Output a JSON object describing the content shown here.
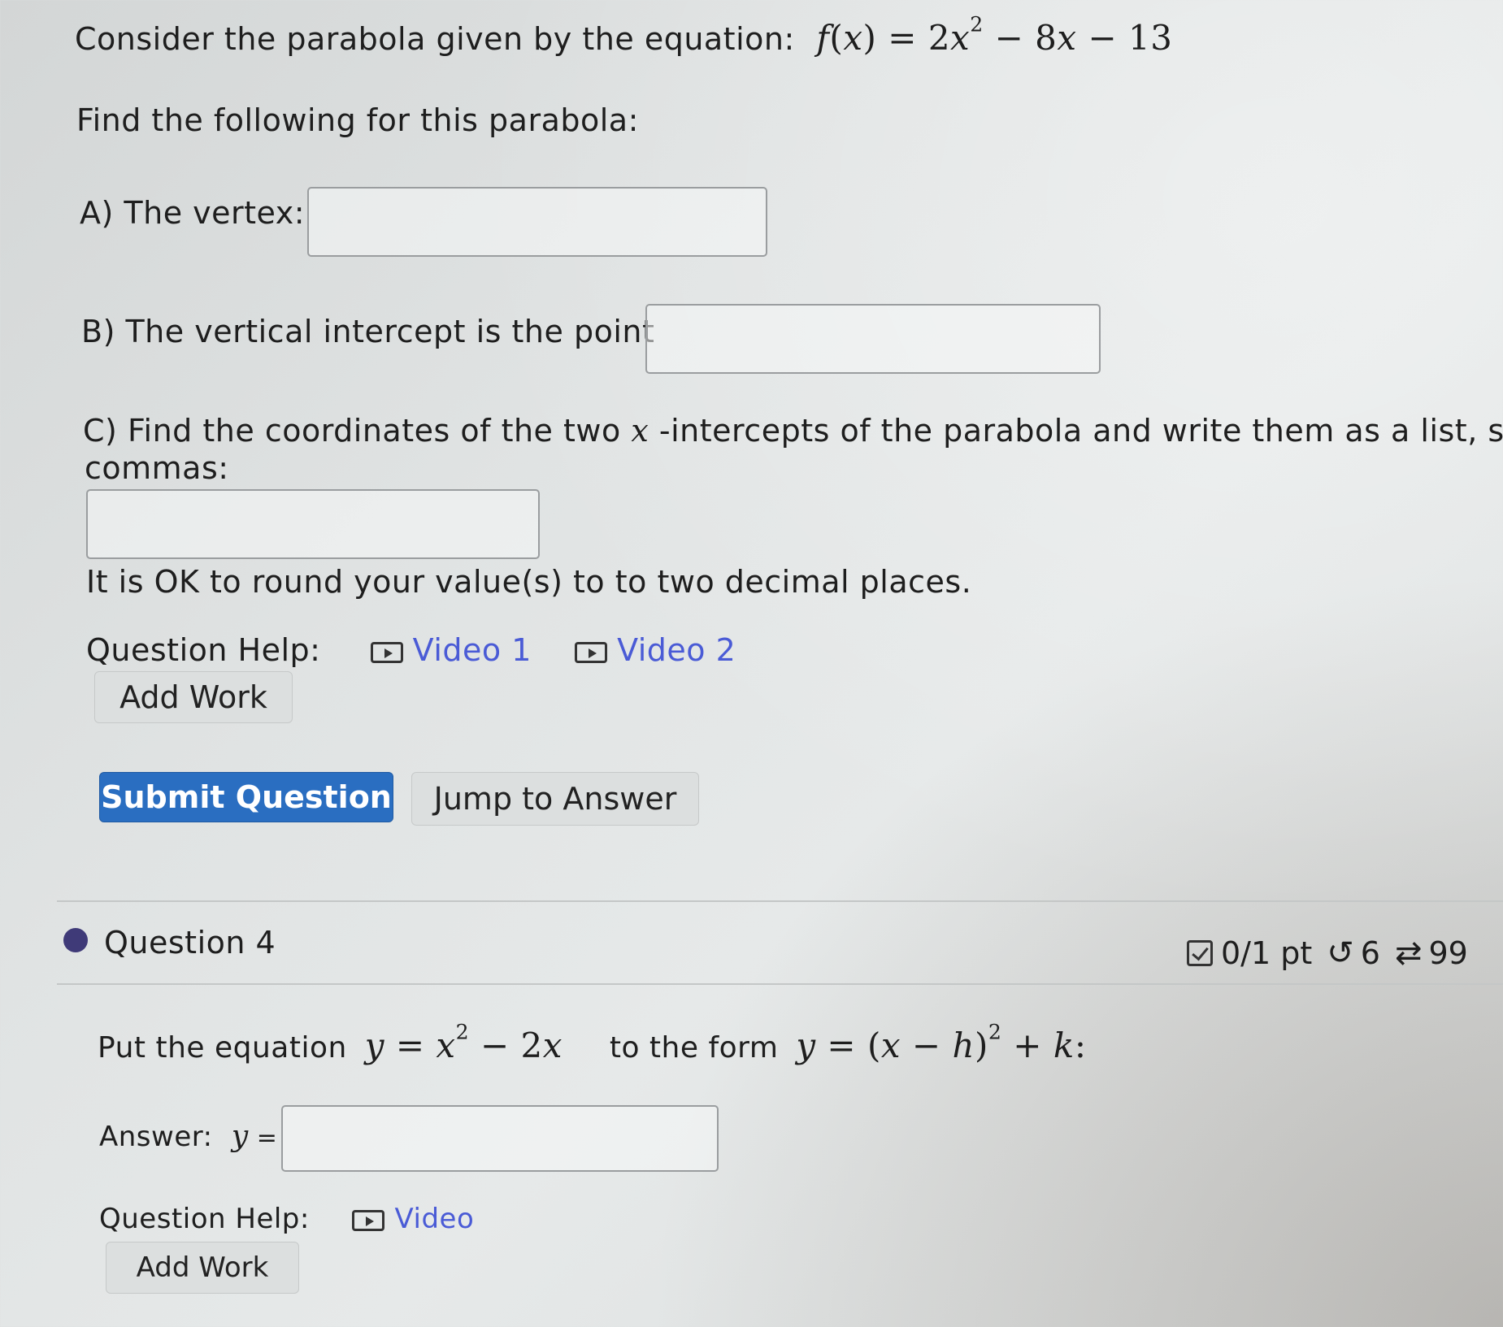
{
  "q3": {
    "prompt": "Consider the parabola given by the equation:",
    "find_text": "Find the following for this parabola:",
    "part_a": "A) The vertex:",
    "part_b": "B) The vertical intercept is the point",
    "part_c_line1": "C) Find the coordinates of the two",
    "part_c_line1_rest": "-intercepts of the parabola and write them as a list, sepa",
    "part_c_line2": "commas:",
    "round_note": "It is OK to round your value(s) to to two decimal places.",
    "help_label": "Question Help:",
    "video1": "Video 1",
    "video2": "Video 2",
    "add_work": "Add Work",
    "submit": "Submit Question",
    "jump": "Jump to Answer",
    "vertex_value": "",
    "vintercept_value": "",
    "xintercepts_value": ""
  },
  "q4": {
    "title": "Question 4",
    "score": "0/1 pt",
    "tries": "6",
    "attempts": "99",
    "prompt_start": "Put the equation",
    "prompt_mid": "to the form",
    "answer_label": "Answer:",
    "help_label": "Question Help:",
    "video": "Video",
    "add_work": "Add Work",
    "answer_value": ""
  }
}
